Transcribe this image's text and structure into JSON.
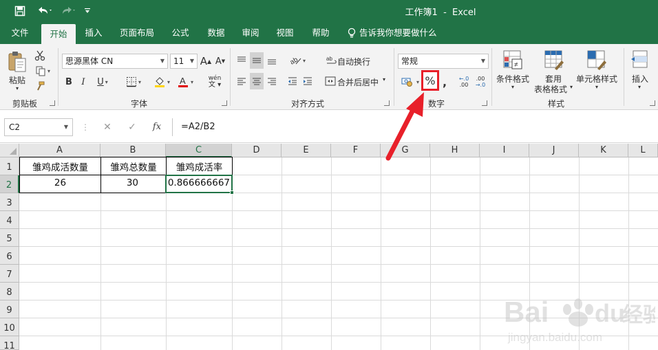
{
  "window": {
    "title": "工作簿1  -  Excel"
  },
  "tabs": [
    {
      "label": "文件"
    },
    {
      "label": "开始"
    },
    {
      "label": "插入"
    },
    {
      "label": "页面布局"
    },
    {
      "label": "公式"
    },
    {
      "label": "数据"
    },
    {
      "label": "审阅"
    },
    {
      "label": "视图"
    },
    {
      "label": "帮助"
    }
  ],
  "tell_me": "告诉我你想要做什么",
  "ribbon": {
    "clipboard": {
      "paste": "粘贴",
      "label": "剪贴板"
    },
    "font": {
      "name": "思源黑体 CN",
      "size": "11",
      "label": "字体",
      "bold": "B",
      "italic": "I",
      "underline": "U",
      "grow": "A",
      "shrink": "A",
      "pinyin": "wén"
    },
    "alignment": {
      "wrap": "自动换行",
      "merge": "合并后居中",
      "label": "对齐方式"
    },
    "number": {
      "format": "常规",
      "percent": "%",
      "comma": ",",
      "label": "数字",
      "inc_decimal": ".00",
      "dec_decimal": ".00"
    },
    "styles": {
      "conditional": "条件格式",
      "table_line1": "套用",
      "table_line2": "表格格式",
      "cell_styles": "单元格样式",
      "label": "样式"
    },
    "cells": {
      "insert": "插入"
    }
  },
  "formula_bar": {
    "name_box": "C2",
    "cancel": "✕",
    "enter": "✓",
    "fx": "fx",
    "formula": "=A2/B2"
  },
  "sheet": {
    "columns": [
      "A",
      "B",
      "C",
      "D",
      "E",
      "F",
      "G",
      "H",
      "I",
      "J",
      "K",
      "L"
    ],
    "rows": [
      "1",
      "2",
      "3",
      "4",
      "5",
      "6",
      "7",
      "8",
      "9",
      "10",
      "11"
    ],
    "cells": {
      "A1": "雏鸡成活数量",
      "B1": "雏鸡总数量",
      "C1": "雏鸡成活率",
      "A2": "26",
      "B2": "30",
      "C2": "0.866666667"
    }
  },
  "watermark": {
    "brand": "Bai",
    "brand2": "du",
    "product": "经验",
    "url": "jingyan.baidu.com"
  },
  "colors": {
    "excel_green": "#217346",
    "highlight_red": "#e8202a"
  }
}
